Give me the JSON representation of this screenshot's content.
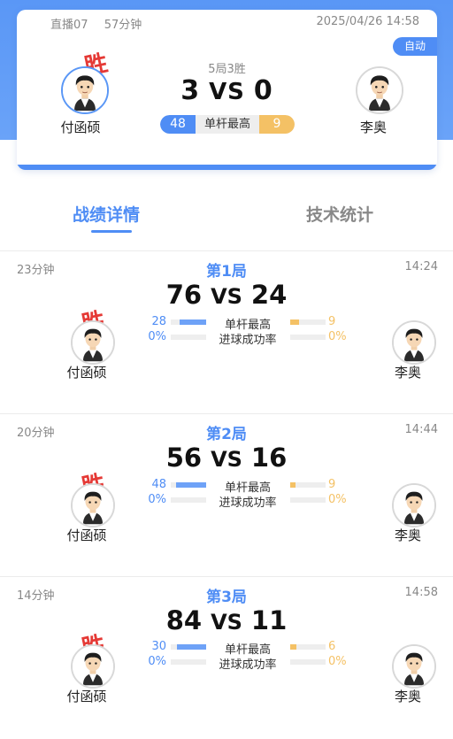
{
  "header": {
    "room": "直播07",
    "duration": "57分钟",
    "datetime": "2025/04/26 14:58",
    "mode_badge": "自动",
    "rule": "5局3胜",
    "score_left": "3",
    "vs": "VS",
    "score_right": "0",
    "highest_break_label": "单杆最高",
    "highest_break_left": "48",
    "highest_break_right": "9",
    "win_mark": "胜"
  },
  "players": {
    "left": "付函硕",
    "right": "李奥"
  },
  "tabs": {
    "active": "战绩详情",
    "inactive": "技术统计"
  },
  "games": [
    {
      "title": "第1局",
      "duration": "23分钟",
      "time": "14:24",
      "score_left": "76",
      "vs": "VS",
      "score_right": "24",
      "win_mark": "胜",
      "stats": [
        {
          "label": "单杆最高",
          "left": "28",
          "right": "9",
          "left_ratio": 0.76,
          "right_ratio": 0.24
        },
        {
          "label": "进球成功率",
          "left": "0%",
          "right": "0%",
          "left_ratio": 0,
          "right_ratio": 0
        }
      ]
    },
    {
      "title": "第2局",
      "duration": "20分钟",
      "time": "14:44",
      "score_left": "56",
      "vs": "VS",
      "score_right": "16",
      "win_mark": "胜",
      "stats": [
        {
          "label": "单杆最高",
          "left": "48",
          "right": "9",
          "left_ratio": 0.84,
          "right_ratio": 0.16
        },
        {
          "label": "进球成功率",
          "left": "0%",
          "right": "0%",
          "left_ratio": 0,
          "right_ratio": 0
        }
      ]
    },
    {
      "title": "第3局",
      "duration": "14分钟",
      "time": "14:58",
      "score_left": "84",
      "vs": "VS",
      "score_right": "11",
      "win_mark": "胜",
      "stats": [
        {
          "label": "单杆最高",
          "left": "30",
          "right": "6",
          "left_ratio": 0.83,
          "right_ratio": 0.17
        },
        {
          "label": "进球成功率",
          "left": "0%",
          "right": "0%",
          "left_ratio": 0,
          "right_ratio": 0
        }
      ]
    }
  ],
  "colors": {
    "primary_blue": "#4f8df5",
    "accent_yellow": "#f4c165",
    "win_red": "#e53935"
  },
  "icons": {
    "avatar": "player-avatar-icon"
  }
}
